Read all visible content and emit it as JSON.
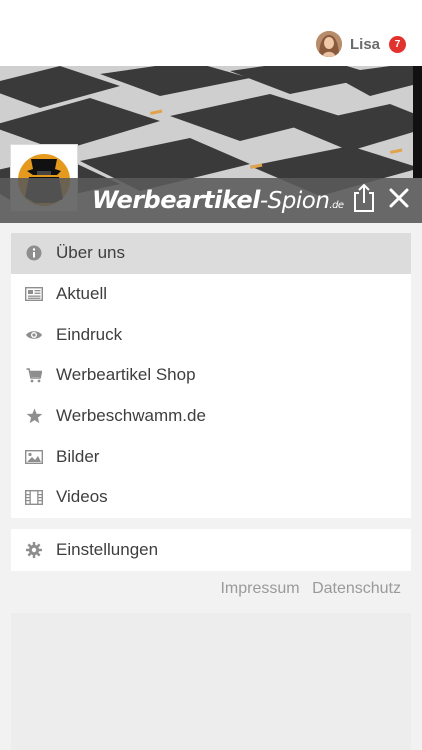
{
  "user": {
    "name": "Lisa",
    "notifications": "7"
  },
  "brand": {
    "name": "Werbeartikel",
    "suffix": "-Spion",
    "tld": ".de"
  },
  "menu": {
    "items": [
      {
        "label": "Über uns",
        "icon": "info-icon"
      },
      {
        "label": "Aktuell",
        "icon": "newspaper-icon"
      },
      {
        "label": "Eindruck",
        "icon": "eye-icon"
      },
      {
        "label": "Werbeartikel Shop",
        "icon": "cart-icon"
      },
      {
        "label": "Werbeschwamm.de",
        "icon": "star-icon"
      },
      {
        "label": "Bilder",
        "icon": "image-icon"
      },
      {
        "label": "Videos",
        "icon": "film-icon"
      }
    ],
    "settings": {
      "label": "Einstellungen",
      "icon": "gear-icon"
    }
  },
  "footer": {
    "impressum": "Impressum",
    "datenschutz": "Datenschutz"
  },
  "colors": {
    "accent": "#e2322d",
    "brandbar": "#5a5a5a",
    "active_item": "#dcdcdc"
  }
}
